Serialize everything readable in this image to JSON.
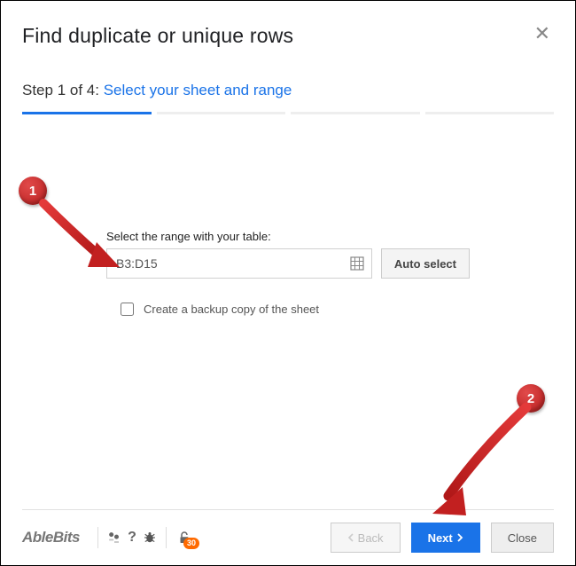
{
  "header": {
    "title": "Find duplicate or unique rows"
  },
  "step": {
    "prefix": "Step 1 of 4: ",
    "link": "Select your sheet and range",
    "current": 1,
    "total": 4
  },
  "form": {
    "range_label": "Select the range with your table:",
    "range_value": "B3:D15",
    "auto_select_label": "Auto select",
    "backup_label": "Create a backup copy of the sheet",
    "backup_checked": false
  },
  "footer": {
    "brand": "AbleBits",
    "badge_count": "30",
    "back_label": "Back",
    "next_label": "Next",
    "close_label": "Close"
  },
  "annotations": {
    "marker1": "1",
    "marker2": "2"
  }
}
